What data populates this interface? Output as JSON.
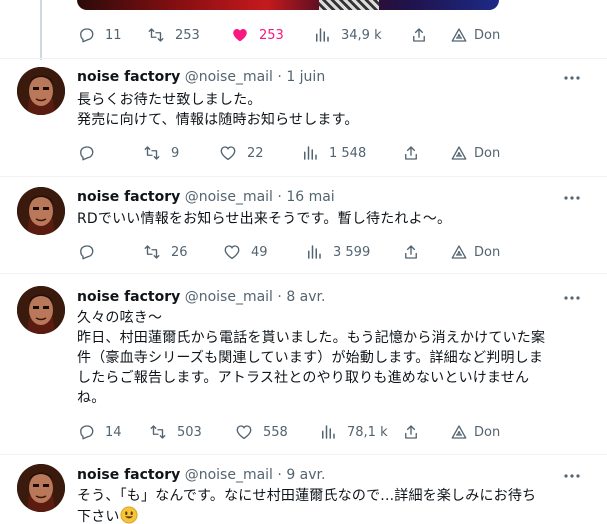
{
  "top_tweet": {
    "actions": {
      "reply": "11",
      "retweet": "253",
      "like": "253",
      "views": "34,9 k",
      "share": "",
      "donate": "Don"
    }
  },
  "tweets": [
    {
      "name": "noise factory",
      "handle": "@noise_mail",
      "separator": "·",
      "date": "1 juin",
      "text": "長らくお待たせ致しました。\n発売に向けて、情報は随時お知らせします。",
      "actions": {
        "reply": "",
        "retweet": "9",
        "like": "22",
        "views": "1 548",
        "donate": "Don"
      }
    },
    {
      "name": "noise factory",
      "handle": "@noise_mail",
      "separator": "·",
      "date": "16 mai",
      "text": "RDでいい情報をお知らせ出来そうです。暫し待たれよ～。",
      "actions": {
        "reply": "",
        "retweet": "26",
        "like": "49",
        "views": "3 599",
        "donate": "Don"
      }
    },
    {
      "name": "noise factory",
      "handle": "@noise_mail",
      "separator": "·",
      "date": "8 avr.",
      "text": "久々の呟き～\n昨日、村田蓮爾氏から電話を貰いました。もう記憶から消えかけていた案\n件（豪血寺シリーズも関連しています）が始動します。詳細など判明しま\nしたらご報告します。アトラス社とのやり取りも進めないといけません\nね。",
      "actions": {
        "reply": "14",
        "retweet": "503",
        "like": "558",
        "views": "78,1 k",
        "donate": "Don"
      }
    },
    {
      "name": "noise factory",
      "handle": "@noise_mail",
      "separator": "·",
      "date": "9 avr.",
      "text": "そう、「も」なんです。なにせ村田蓮爾氏なので...詳細を楽しみにお待ち\n下さい",
      "emoji": "smiling-face-emoji"
    }
  ],
  "colors": {
    "text": "#0f1419",
    "muted": "#536471",
    "like": "#f91880",
    "divider": "#eff3f4",
    "thread": "#cfd9de"
  }
}
